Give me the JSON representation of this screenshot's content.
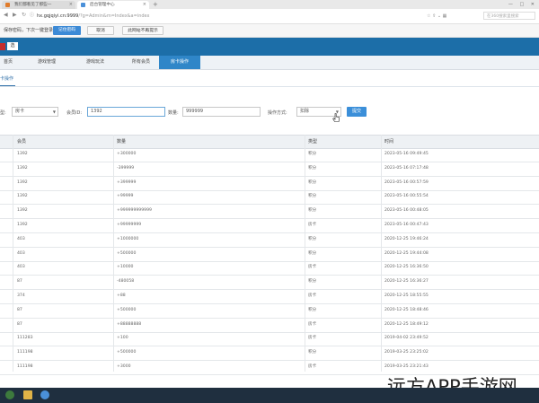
{
  "browser": {
    "tabs": [
      "我们都看见了那些一",
      "后台管理中心"
    ],
    "url_host": "hx.gqjqiyi.cn:9999",
    "url_path": "/?g=Admin&m=Index&a=index",
    "search_placeholder": "在360搜索里搜索",
    "window_controls": "— □ ✕"
  },
  "notification": {
    "text": "保存密码，下次一键登录!",
    "buttons": [
      "记住密码",
      "取消",
      "此网站不再提示"
    ]
  },
  "app": {
    "header_button": "选"
  },
  "main_nav": [
    "首页",
    "游戏管理",
    "游戏玩法",
    "所有会员",
    "房卡操作"
  ],
  "active_nav_index": 4,
  "sub_tab": "卡操作",
  "filter": {
    "type_label": "型:",
    "type_value": "房卡",
    "member_label": "会员ID:",
    "member_value": "1392",
    "amount_label": "数量:",
    "amount_value": "999999",
    "op_label": "操作方式:",
    "op_value": "扣除",
    "submit": "提交"
  },
  "table": {
    "columns": [
      "会员",
      "数量",
      "类型",
      "时间"
    ],
    "rows": [
      [
        "1392",
        "+300000",
        "积分",
        "2023-05-16 09:49:45"
      ],
      [
        "1392",
        "-399999",
        "积分",
        "2023-05-16 07:17:48"
      ],
      [
        "1392",
        "+399999",
        "积分",
        "2023-05-16 00:57:59"
      ],
      [
        "1392",
        "+99999",
        "积分",
        "2023-05-16 00:55:54"
      ],
      [
        "1392",
        "+999999999999",
        "积分",
        "2023-05-16 00:48:05"
      ],
      [
        "1392",
        "+99999999",
        "房卡",
        "2023-05-16 00:47:43"
      ],
      [
        "403",
        "+1000000",
        "积分",
        "2020-12-25 19:46:24"
      ],
      [
        "403",
        "+500000",
        "积分",
        "2020-12-25 19:44:08"
      ],
      [
        "403",
        "+10000",
        "房卡",
        "2020-12-25 16:36:50"
      ],
      [
        "87",
        "-480058",
        "积分",
        "2020-12-25 16:36:27"
      ],
      [
        "374",
        "+88",
        "房卡",
        "2020-12-25 18:55:55"
      ],
      [
        "87",
        "+500000",
        "积分",
        "2020-12-25 18:48:46"
      ],
      [
        "87",
        "+88888888",
        "房卡",
        "2020-12-25 18:49:12"
      ],
      [
        "111283",
        "+100",
        "房卡",
        "2019-04-02 23:49:52"
      ],
      [
        "111198",
        "+500000",
        "积分",
        "2019-03-25 23:25:02"
      ],
      [
        "111198",
        "+3000",
        "房卡",
        "2019-03-25 23:21:43"
      ]
    ]
  },
  "watermark": "远方APP手游网",
  "colors": {
    "header_blue": "#1c6ea8",
    "active_tab": "#2f86c8",
    "button_blue": "#3b8fd9",
    "badge_red": "#c62d2d"
  }
}
